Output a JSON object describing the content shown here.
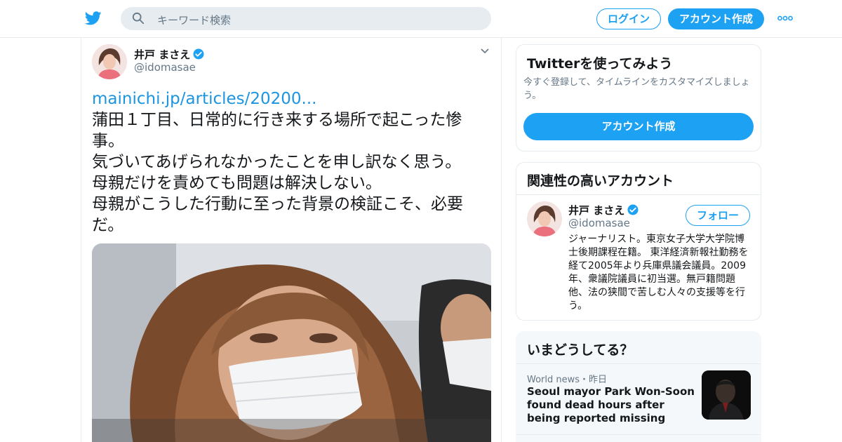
{
  "header": {
    "search_placeholder": "キーワード検索",
    "login_label": "ログイン",
    "signup_label": "アカウント作成"
  },
  "tweet": {
    "author_name": "井戸 まさえ",
    "author_handle": "@idomasae",
    "link": "mainichi.jp/articles/20200...",
    "lines": [
      "蒲田１丁目、日常的に行き来する場所で起こった惨",
      "事。",
      "気づいてあげられなかったことを申し訳なく思う。",
      "母親だけを責めても問題は解決しない。",
      "母親がこうした行動に至った背景の検証こそ、必要",
      "だ。"
    ]
  },
  "signup_card": {
    "title": "Twitterを使ってみよう",
    "description": "今すぐ登録して、タイムラインをカスタマイズしましょう。",
    "button_label": "アカウント作成"
  },
  "related_card": {
    "title": "関連性の高いアカウント",
    "account_name": "井戸 まさえ",
    "account_handle": "@idomasae",
    "follow_label": "フォロー",
    "bio": "ジャーナリスト。東京女子大学大学院博士後期課程在籍。 東洋経済新報社勤務を経て2005年より兵庫県議会議員。2009年、衆議院議員に初当選。無戸籍問題他、法の狭間で苦しむ人々の支援等を行う。"
  },
  "trends_card": {
    "title": "いまどうしてる？",
    "item": {
      "meta": "World news・昨日",
      "headline": "Seoul mayor Park Won-Soon found dead hours after being reported missing"
    }
  },
  "colors": {
    "brand": "#1da1f2",
    "link": "#1b95e0",
    "secondary_text": "#657786",
    "border": "#e6ecf0"
  },
  "icons": {
    "logo": "twitter-bird-icon",
    "search": "search-icon",
    "more": "more-dots-icon",
    "verified": "verified-badge-icon",
    "caret": "chevron-down-icon"
  }
}
